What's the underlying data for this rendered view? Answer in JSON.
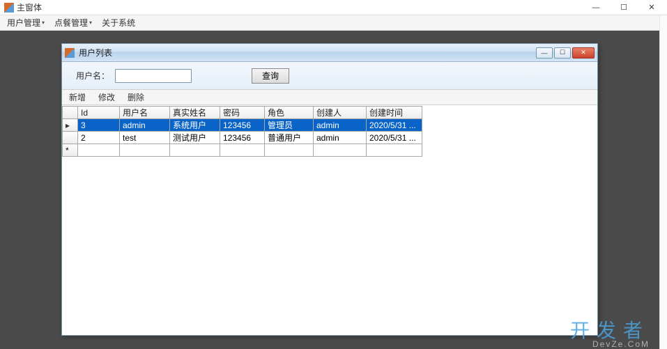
{
  "outer": {
    "title": "主窗体",
    "controls": {
      "min": "—",
      "max": "☐",
      "close": "✕"
    }
  },
  "menubar": {
    "items": [
      {
        "label": "用户管理",
        "hasSub": true
      },
      {
        "label": "点餐管理",
        "hasSub": true
      },
      {
        "label": "关于系统",
        "hasSub": false
      }
    ]
  },
  "child": {
    "title": "用户列表",
    "controls": {
      "min": "—",
      "max": "☐",
      "close": "✕"
    }
  },
  "search": {
    "label": "用户名：",
    "value": "",
    "placeholder": "",
    "button": "查询"
  },
  "toolbar": {
    "add": "新增",
    "edit": "修改",
    "delete": "删除"
  },
  "grid": {
    "columns": [
      "Id",
      "用户名",
      "真实姓名",
      "密码",
      "角色",
      "创建人",
      "创建时间"
    ],
    "rows": [
      {
        "selected": true,
        "marker": "▸",
        "cells": [
          "3",
          "admin",
          "系统用户",
          "123456",
          "管理员",
          "admin",
          "2020/5/31 ..."
        ]
      },
      {
        "selected": false,
        "marker": "",
        "cells": [
          "2",
          "test",
          "测试用户",
          "123456",
          "普通用户",
          "admin",
          "2020/5/31 ..."
        ]
      },
      {
        "selected": false,
        "marker": "*",
        "cells": [
          "",
          "",
          "",
          "",
          "",
          "",
          ""
        ]
      }
    ]
  },
  "watermark": {
    "main": "开发者",
    "sub": "DevZe.CoM"
  }
}
